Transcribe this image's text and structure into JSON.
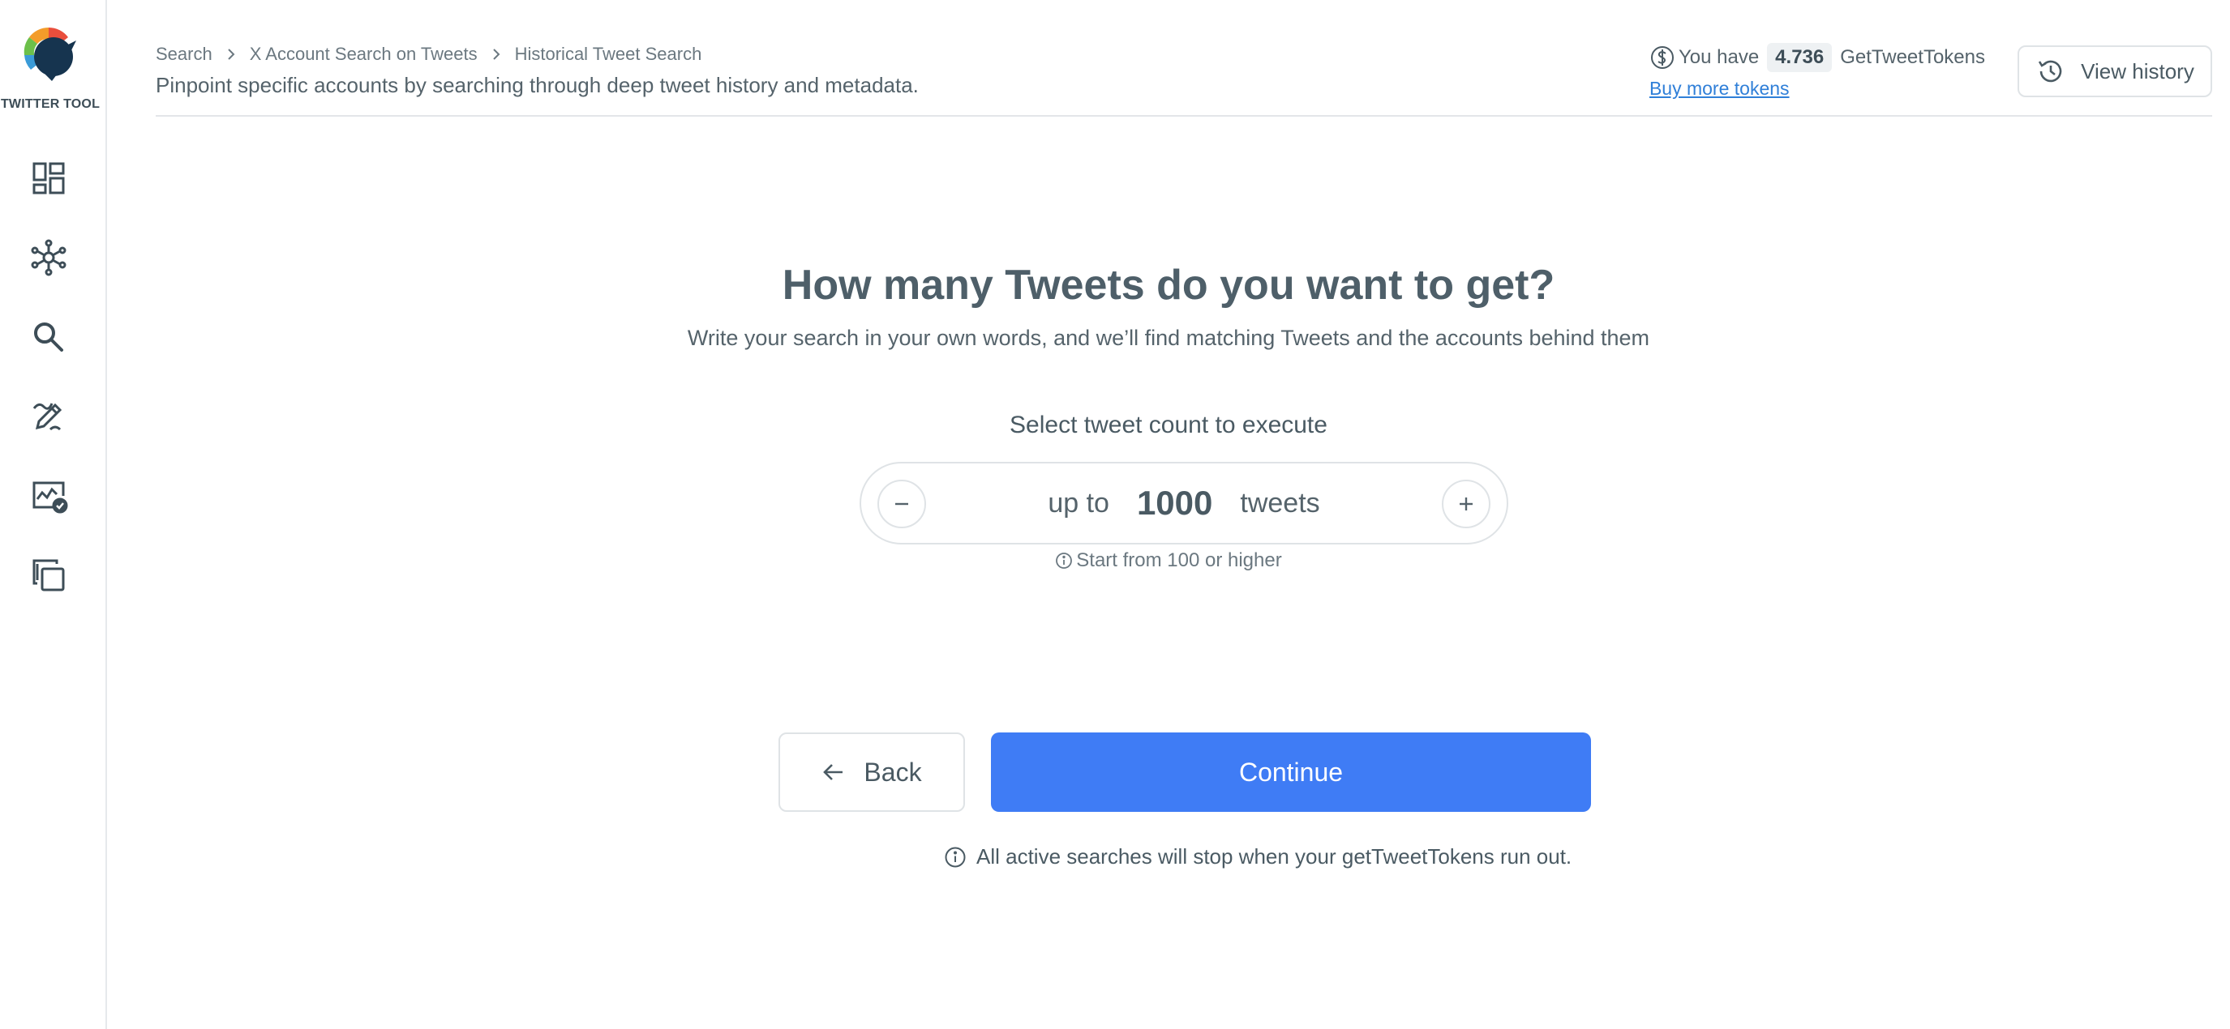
{
  "sidebar": {
    "brand": "TWITTER TOOL",
    "items": [
      {
        "icon": "dashboard-icon"
      },
      {
        "icon": "network-icon"
      },
      {
        "icon": "search-icon"
      },
      {
        "icon": "edit-icon"
      },
      {
        "icon": "analytics-icon"
      },
      {
        "icon": "copy-icon"
      }
    ]
  },
  "header": {
    "breadcrumb": [
      "Search",
      "X Account Search on Tweets",
      "Historical Tweet Search"
    ],
    "subtitle": "Pinpoint specific accounts by searching through deep tweet history and metadata.",
    "tokens": {
      "prefix": "You have",
      "amount": "4.736",
      "unit": "GetTweetTokens",
      "buy_label": "Buy more tokens"
    },
    "history_label": "View history"
  },
  "main": {
    "title": "How many Tweets do you want to get?",
    "subtitle": "Write your search in your own words, and we’ll find matching Tweets and the accounts behind them",
    "count_label": "Select tweet count to execute",
    "stepper": {
      "prefix": "up to",
      "value": "1000",
      "suffix": "tweets"
    },
    "hint": "Start from 100 or higher",
    "back_label": "Back",
    "continue_label": "Continue",
    "notice": "All active searches will stop when your getTweetTokens run out."
  },
  "colors": {
    "accent": "#3f7cf5",
    "link": "#2f7fd8",
    "text": "#4a5a63",
    "border": "#dfe3e6"
  }
}
